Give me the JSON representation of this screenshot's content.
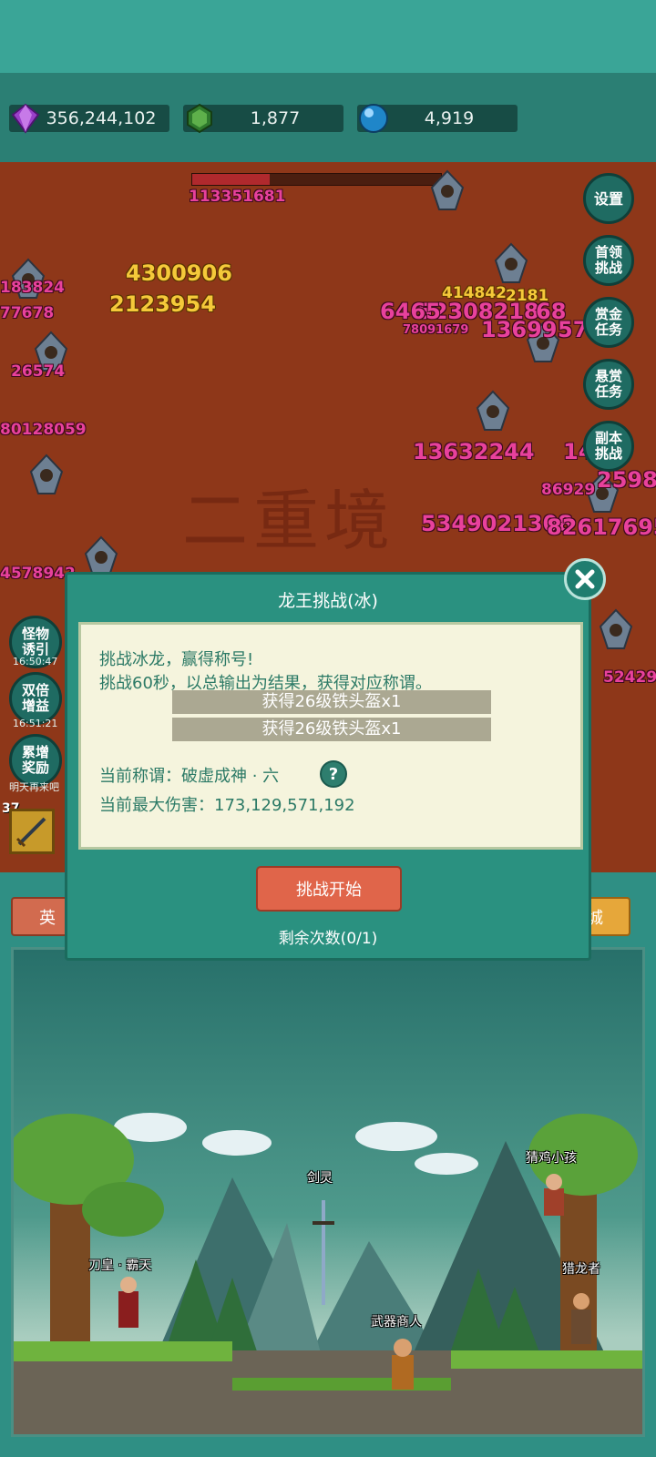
{
  "resources": {
    "diamonds": "356,244,102",
    "emeralds": "1,877",
    "orbs": "4,919"
  },
  "battle": {
    "boss_hp_damage": "113351681",
    "watermark": "二重境",
    "damage_numbers": [
      "113351681",
      "4300906",
      "2123954",
      "183824",
      "77678",
      "26574",
      "52308218",
      "68",
      "6465",
      "80128059",
      "13632244",
      "5349021308",
      "82617695",
      "2598",
      "86929",
      "4578942",
      "52429",
      "414842",
      "2181",
      "78091679",
      "136995",
      "57",
      "1462"
    ],
    "hp_fraction": 0.31
  },
  "side_buttons": {
    "settings": "设置",
    "boss": [
      "首领",
      "挑战"
    ],
    "bounty_gold": [
      "赏金",
      "任务"
    ],
    "bounty_reward": [
      "悬赏",
      "任务"
    ],
    "dungeon": [
      "副本",
      "挑战"
    ]
  },
  "left_buttons": {
    "monster_lure": [
      "怪物",
      "诱引"
    ],
    "monster_lure_timer": "16:50:47",
    "double_gain": [
      "双倍",
      "增益"
    ],
    "double_gain_timer": "16:51:21",
    "cumulative_reward": [
      "累增",
      "奖励"
    ],
    "cumulative_reward_note": "明天再来吧"
  },
  "skill": {
    "level": "37"
  },
  "tabs": {
    "left": "英",
    "right": "城"
  },
  "scene_npcs": {
    "blade_emperor": "刀皇 · 霸天",
    "sword_spirit": "剑灵",
    "weapon_merchant": "武器商人",
    "chicken_kid": "猜鸡小孩",
    "dragon_hunter": "猎龙者"
  },
  "dialog": {
    "title": "龙王挑战(冰)",
    "line1": "挑战冰龙，赢得称号!",
    "line2": "挑战60秒，以总输出为结果，获得对应称谓。",
    "reward1": "获得26级铁头盔x1",
    "reward2": "获得26级铁头盔x1",
    "current_title": "当前称谓：破虚成神 · 六",
    "help": "?",
    "max_damage": "当前最大伤害：173,129,571,192",
    "start_button": "挑战开始",
    "remaining": "剩余次数(0/1)"
  }
}
